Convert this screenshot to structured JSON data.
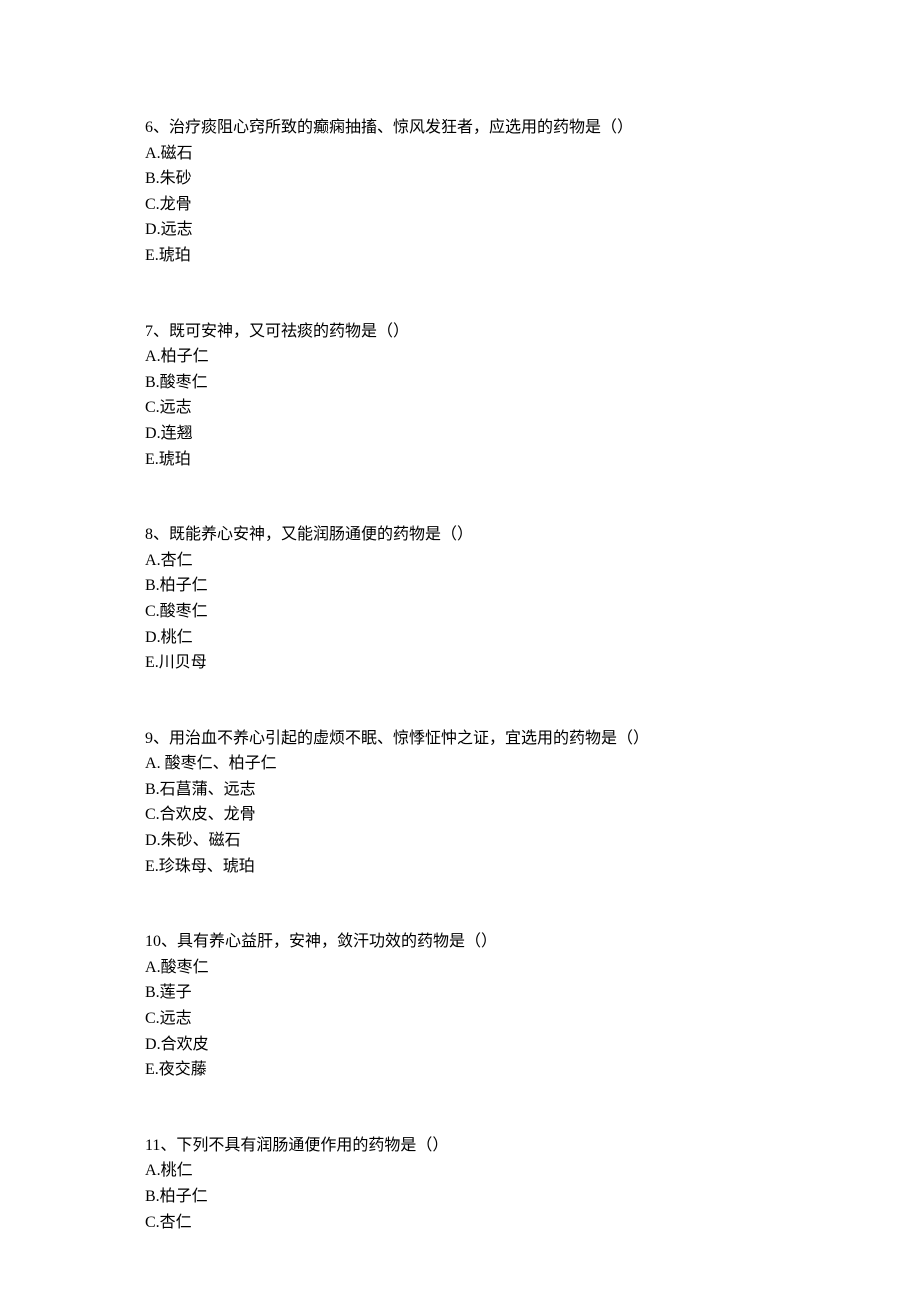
{
  "questions": [
    {
      "number": "6",
      "stem": "治疗痰阻心窍所致的癫痫抽搐、惊风发狂者，应选用的药物是（）",
      "options": [
        {
          "letter": "A",
          "text": "磁石"
        },
        {
          "letter": "B",
          "text": "朱砂"
        },
        {
          "letter": "C",
          "text": "龙骨"
        },
        {
          "letter": "D",
          "text": "远志"
        },
        {
          "letter": "E",
          "text": "琥珀"
        }
      ]
    },
    {
      "number": "7",
      "stem": "既可安神，又可祛痰的药物是（）",
      "options": [
        {
          "letter": "A",
          "text": "柏子仁"
        },
        {
          "letter": "B",
          "text": "酸枣仁"
        },
        {
          "letter": "C",
          "text": "远志"
        },
        {
          "letter": "D",
          "text": "连翘"
        },
        {
          "letter": "E",
          "text": "琥珀"
        }
      ]
    },
    {
      "number": "8",
      "stem": "既能养心安神，又能润肠通便的药物是（）",
      "options": [
        {
          "letter": "A",
          "text": "杏仁"
        },
        {
          "letter": "B",
          "text": "柏子仁"
        },
        {
          "letter": "C",
          "text": "酸枣仁"
        },
        {
          "letter": "D",
          "text": "桃仁"
        },
        {
          "letter": "E",
          "text": "川贝母"
        }
      ]
    },
    {
      "number": "9",
      "stem": "用治血不养心引起的虚烦不眠、惊悸怔忡之证，宜选用的药物是（）",
      "options": [
        {
          "letter": "A",
          "text": " 酸枣仁、柏子仁"
        },
        {
          "letter": "B",
          "text": "石菖蒲、远志"
        },
        {
          "letter": "C",
          "text": "合欢皮、龙骨"
        },
        {
          "letter": "D",
          "text": "朱砂、磁石"
        },
        {
          "letter": "E",
          "text": "珍珠母、琥珀"
        }
      ]
    },
    {
      "number": "10",
      "stem": "具有养心益肝，安神，敛汗功效的药物是（）",
      "options": [
        {
          "letter": "A",
          "text": "酸枣仁"
        },
        {
          "letter": "B",
          "text": "莲子"
        },
        {
          "letter": "C",
          "text": "远志"
        },
        {
          "letter": "D",
          "text": "合欢皮"
        },
        {
          "letter": "E",
          "text": "夜交藤"
        }
      ]
    },
    {
      "number": "11",
      "stem": "下列不具有润肠通便作用的药物是（）",
      "options": [
        {
          "letter": "A",
          "text": "桃仁"
        },
        {
          "letter": "B",
          "text": "柏子仁"
        },
        {
          "letter": "C",
          "text": "杏仁"
        }
      ]
    }
  ],
  "separators": {
    "numSep": "、",
    "optSep": "."
  }
}
